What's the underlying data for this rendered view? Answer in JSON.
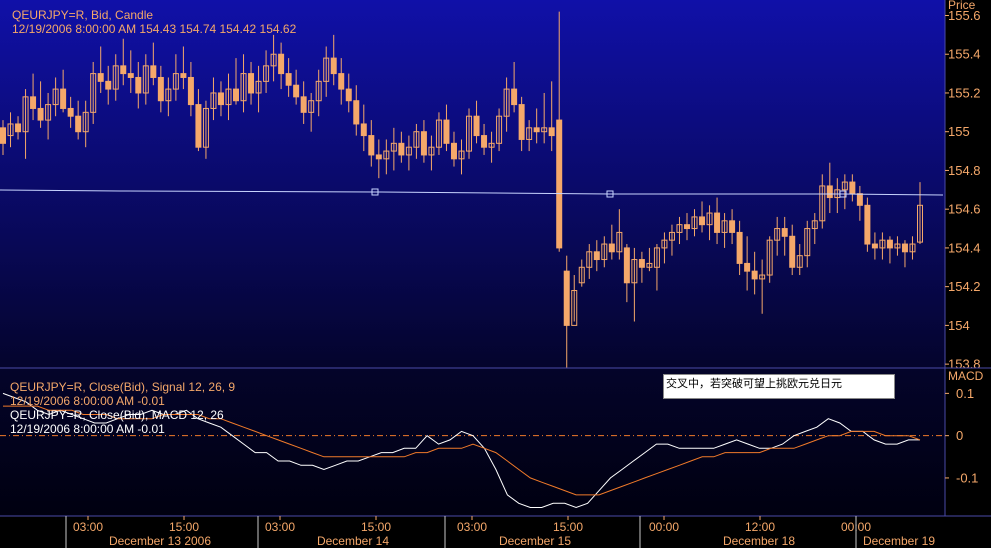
{
  "theme": {
    "upper_gradient_top": "#1010a8",
    "upper_gradient_bottom": "#04042c",
    "lower_gradient_top": "#04042a",
    "lower_gradient_bottom": "#000010",
    "candle_color": "#f5a86a",
    "macd_color": "#ffffff",
    "signal_color": "#f07a2a",
    "axis_text": "#f5a86a",
    "separator": "#4a4aa8"
  },
  "price_pane": {
    "title": "QEURJPY=R, Bid, Candle",
    "ohlc_text": "12/19/2006 8:00:00 AM 154.43 154.74 154.42 154.62",
    "axis_label": "Price",
    "trendline_color": "#c8d4ff"
  },
  "macd_pane": {
    "signal_title": "QEURJPY=R, Close(Bid), Signal 12, 26, 9",
    "signal_value_text": "12/19/2006 8:00:00 AM -0.01",
    "macd_title": "QEURJPY=R, Close(Bid), MACD 12, 26",
    "macd_value_text": "12/19/2006 8:00:00 AM -0.01",
    "axis_label": "MACD",
    "annotation": "交叉中，若突破可望上挑欧元兑日元"
  },
  "time_axis": {
    "ticks": [
      "03:00",
      "15:00",
      "03:00",
      "15:00",
      "03:00",
      "15:00",
      "00:00",
      "12:00",
      "00:00"
    ],
    "dates": [
      "December 13 2006",
      "December 14",
      "December 15",
      "December 18",
      "December 19"
    ]
  },
  "chart_data": [
    {
      "type": "candlestick",
      "title": "QEURJPY=R, Bid, Candle",
      "ylabel": "Price",
      "ylim": [
        153.78,
        155.68
      ],
      "yticks": [
        155.6,
        155.4,
        155.2,
        155,
        154.8,
        154.6,
        154.4,
        154.2,
        154,
        153.8
      ],
      "ytick_labels": [
        "155.6",
        "155.4",
        "155.2",
        "155",
        "154.8",
        "154.6",
        "154.4",
        "154.2",
        "154",
        "153.8"
      ],
      "last": {
        "time": "12/19/2006 8:00:00 AM",
        "open": 154.43,
        "high": 154.74,
        "low": 154.42,
        "close": 154.62
      },
      "candles": [
        [
          155.02,
          155.06,
          154.88,
          154.94
        ],
        [
          154.98,
          155.1,
          154.92,
          155.04
        ],
        [
          155.04,
          155.08,
          154.96,
          155.0
        ],
        [
          155.0,
          155.22,
          154.86,
          155.18
        ],
        [
          155.18,
          155.3,
          155.06,
          155.12
        ],
        [
          155.12,
          155.26,
          155.02,
          155.06
        ],
        [
          155.06,
          155.2,
          154.96,
          155.14
        ],
        [
          155.14,
          155.28,
          155.08,
          155.22
        ],
        [
          155.22,
          155.32,
          155.1,
          155.12
        ],
        [
          155.12,
          155.18,
          155.02,
          155.08
        ],
        [
          155.08,
          155.16,
          154.96,
          155.0
        ],
        [
          155.0,
          155.16,
          154.92,
          155.1
        ],
        [
          155.1,
          155.36,
          155.04,
          155.3
        ],
        [
          155.3,
          155.44,
          155.2,
          155.26
        ],
        [
          155.26,
          155.34,
          155.14,
          155.22
        ],
        [
          155.22,
          155.4,
          155.16,
          155.34
        ],
        [
          155.34,
          155.48,
          155.24,
          155.3
        ],
        [
          155.3,
          155.42,
          155.2,
          155.28
        ],
        [
          155.28,
          155.36,
          155.12,
          155.2
        ],
        [
          155.2,
          155.4,
          155.14,
          155.34
        ],
        [
          155.34,
          155.46,
          155.24,
          155.28
        ],
        [
          155.28,
          155.34,
          155.1,
          155.16
        ],
        [
          155.16,
          155.28,
          155.08,
          155.22
        ],
        [
          155.22,
          155.4,
          155.16,
          155.3
        ],
        [
          155.3,
          155.44,
          155.22,
          155.28
        ],
        [
          155.28,
          155.36,
          155.08,
          155.14
        ],
        [
          155.14,
          155.22,
          154.9,
          154.92
        ],
        [
          154.92,
          155.16,
          154.86,
          155.12
        ],
        [
          155.12,
          155.28,
          155.06,
          155.2
        ],
        [
          155.2,
          155.26,
          155.08,
          155.14
        ],
        [
          155.14,
          155.3,
          155.06,
          155.22
        ],
        [
          155.22,
          155.38,
          155.14,
          155.16
        ],
        [
          155.16,
          155.4,
          155.1,
          155.3
        ],
        [
          155.3,
          155.36,
          155.14,
          155.2
        ],
        [
          155.2,
          155.34,
          155.1,
          155.26
        ],
        [
          155.26,
          155.42,
          155.2,
          155.34
        ],
        [
          155.34,
          155.5,
          155.26,
          155.4
        ],
        [
          155.4,
          155.46,
          155.22,
          155.3
        ],
        [
          155.3,
          155.38,
          155.18,
          155.24
        ],
        [
          155.24,
          155.32,
          155.14,
          155.18
        ],
        [
          155.18,
          155.26,
          155.04,
          155.1
        ],
        [
          155.1,
          155.2,
          155.0,
          155.16
        ],
        [
          155.16,
          155.32,
          155.08,
          155.26
        ],
        [
          155.26,
          155.44,
          155.18,
          155.38
        ],
        [
          155.38,
          155.5,
          155.24,
          155.3
        ],
        [
          155.3,
          155.38,
          155.14,
          155.22
        ],
        [
          155.22,
          155.3,
          155.1,
          155.16
        ],
        [
          155.16,
          155.24,
          154.98,
          155.04
        ],
        [
          155.04,
          155.14,
          154.9,
          154.98
        ],
        [
          154.98,
          155.06,
          154.82,
          154.88
        ],
        [
          154.88,
          154.96,
          154.76,
          154.86
        ],
        [
          154.86,
          154.96,
          154.78,
          154.9
        ],
        [
          154.9,
          155.02,
          154.8,
          154.94
        ],
        [
          154.94,
          155.0,
          154.84,
          154.88
        ],
        [
          154.88,
          154.98,
          154.8,
          154.92
        ],
        [
          154.92,
          155.04,
          154.86,
          155.0
        ],
        [
          155.0,
          155.06,
          154.84,
          154.88
        ],
        [
          154.88,
          154.98,
          154.8,
          154.92
        ],
        [
          154.92,
          155.1,
          154.88,
          155.06
        ],
        [
          155.06,
          155.14,
          154.9,
          154.94
        ],
        [
          154.94,
          155.0,
          154.82,
          154.86
        ],
        [
          154.86,
          154.96,
          154.78,
          154.9
        ],
        [
          154.9,
          155.12,
          154.86,
          155.08
        ],
        [
          155.08,
          155.16,
          154.94,
          154.98
        ],
        [
          154.98,
          155.04,
          154.88,
          154.92
        ],
        [
          154.92,
          155.0,
          154.84,
          154.94
        ],
        [
          154.94,
          155.12,
          154.9,
          155.08
        ],
        [
          155.08,
          155.28,
          155.0,
          155.22
        ],
        [
          155.22,
          155.36,
          155.1,
          155.14
        ],
        [
          155.14,
          155.18,
          154.9,
          154.96
        ],
        [
          154.96,
          155.06,
          154.9,
          155.02
        ],
        [
          155.02,
          155.12,
          154.94,
          155.0
        ],
        [
          155.0,
          155.2,
          154.94,
          155.02
        ],
        [
          155.02,
          155.26,
          154.9,
          154.98
        ],
        [
          155.06,
          155.62,
          154.38,
          154.4
        ],
        [
          154.28,
          154.36,
          153.78,
          154.0
        ],
        [
          154.0,
          154.26,
          154.02,
          154.18
        ],
        [
          154.22,
          154.34,
          154.2,
          154.3
        ],
        [
          154.3,
          154.42,
          154.24,
          154.38
        ],
        [
          154.38,
          154.44,
          154.28,
          154.34
        ],
        [
          154.34,
          154.46,
          154.3,
          154.42
        ],
        [
          154.42,
          154.52,
          154.34,
          154.38
        ],
        [
          154.38,
          154.6,
          154.34,
          154.48
        ],
        [
          154.4,
          154.42,
          154.12,
          154.22
        ],
        [
          154.22,
          154.4,
          154.02,
          154.34
        ],
        [
          154.34,
          154.38,
          154.22,
          154.3
        ],
        [
          154.3,
          154.4,
          154.28,
          154.32
        ],
        [
          154.3,
          154.42,
          154.18,
          154.4
        ],
        [
          154.4,
          154.48,
          154.32,
          154.44
        ],
        [
          154.44,
          154.52,
          154.36,
          154.48
        ],
        [
          154.48,
          154.56,
          154.42,
          154.52
        ],
        [
          154.52,
          154.58,
          154.44,
          154.5
        ],
        [
          154.5,
          154.6,
          154.46,
          154.56
        ],
        [
          154.56,
          154.64,
          154.48,
          154.52
        ],
        [
          154.52,
          154.62,
          154.44,
          154.58
        ],
        [
          154.58,
          154.66,
          154.42,
          154.48
        ],
        [
          154.48,
          154.58,
          154.4,
          154.54
        ],
        [
          154.54,
          154.6,
          154.42,
          154.48
        ],
        [
          154.48,
          154.54,
          154.26,
          154.32
        ],
        [
          154.32,
          154.46,
          154.18,
          154.28
        ],
        [
          154.28,
          154.38,
          154.16,
          154.24
        ],
        [
          154.24,
          154.34,
          154.06,
          154.26
        ],
        [
          154.26,
          154.46,
          154.22,
          154.44
        ],
        [
          154.44,
          154.56,
          154.36,
          154.5
        ],
        [
          154.5,
          154.56,
          154.36,
          154.46
        ],
        [
          154.46,
          154.52,
          154.26,
          154.3
        ],
        [
          154.3,
          154.42,
          154.26,
          154.36
        ],
        [
          154.36,
          154.54,
          154.3,
          154.5
        ],
        [
          154.5,
          154.58,
          154.42,
          154.54
        ],
        [
          154.54,
          154.78,
          154.5,
          154.72
        ],
        [
          154.72,
          154.84,
          154.58,
          154.66
        ],
        [
          154.66,
          154.76,
          154.58,
          154.7
        ],
        [
          154.7,
          154.78,
          154.6,
          154.74
        ],
        [
          154.74,
          154.78,
          154.64,
          154.68
        ],
        [
          154.68,
          154.72,
          154.54,
          154.62
        ],
        [
          154.62,
          154.66,
          154.38,
          154.42
        ],
        [
          154.42,
          154.48,
          154.34,
          154.4
        ],
        [
          154.4,
          154.48,
          154.34,
          154.44
        ],
        [
          154.44,
          154.46,
          154.32,
          154.4
        ],
        [
          154.4,
          154.46,
          154.36,
          154.42
        ],
        [
          154.42,
          154.44,
          154.3,
          154.38
        ],
        [
          154.38,
          154.46,
          154.34,
          154.42
        ],
        [
          154.43,
          154.74,
          154.42,
          154.62
        ]
      ]
    },
    {
      "type": "line",
      "ylabel": "MACD",
      "ylim": [
        -0.19,
        0.16
      ],
      "yticks": [
        0.1,
        0,
        -0.1
      ],
      "ytick_labels": [
        "0.1",
        "0",
        "-0.1"
      ],
      "zero_line": 0,
      "series": [
        {
          "name": "QEURJPY=R, Close(Bid), MACD 12, 26",
          "color": "#ffffff",
          "values": [
            0.1,
            0.09,
            0.08,
            0.06,
            0.05,
            0.06,
            0.05,
            0.04,
            0.03,
            0.03,
            0.04,
            0.05,
            0.05,
            0.06,
            0.05,
            0.05,
            0.06,
            0.04,
            0.03,
            0.02,
            0.0,
            -0.02,
            -0.04,
            -0.04,
            -0.06,
            -0.06,
            -0.07,
            -0.07,
            -0.08,
            -0.07,
            -0.06,
            -0.06,
            -0.05,
            -0.04,
            -0.04,
            -0.03,
            -0.03,
            0.0,
            -0.02,
            -0.01,
            0.01,
            0.0,
            -0.03,
            -0.08,
            -0.14,
            -0.16,
            -0.17,
            -0.17,
            -0.16,
            -0.16,
            -0.17,
            -0.16,
            -0.13,
            -0.1,
            -0.08,
            -0.06,
            -0.04,
            -0.02,
            -0.02,
            -0.03,
            -0.03,
            -0.03,
            -0.03,
            -0.02,
            -0.01,
            -0.02,
            -0.03,
            -0.03,
            -0.02,
            0.0,
            0.01,
            0.02,
            0.04,
            0.03,
            0.01,
            0.01,
            -0.01,
            -0.02,
            -0.02,
            -0.01,
            -0.01
          ]
        },
        {
          "name": "QEURJPY=R, Close(Bid), Signal 12, 26, 9",
          "color": "#f07a2a",
          "values": [
            0.07,
            0.07,
            0.07,
            0.07,
            0.06,
            0.06,
            0.06,
            0.05,
            0.05,
            0.05,
            0.04,
            0.04,
            0.04,
            0.04,
            0.05,
            0.05,
            0.05,
            0.05,
            0.04,
            0.04,
            0.03,
            0.02,
            0.01,
            0.0,
            -0.01,
            -0.02,
            -0.03,
            -0.04,
            -0.05,
            -0.05,
            -0.05,
            -0.05,
            -0.05,
            -0.05,
            -0.05,
            -0.05,
            -0.04,
            -0.04,
            -0.03,
            -0.03,
            -0.03,
            -0.02,
            -0.03,
            -0.04,
            -0.06,
            -0.08,
            -0.1,
            -0.11,
            -0.12,
            -0.13,
            -0.14,
            -0.14,
            -0.14,
            -0.13,
            -0.12,
            -0.11,
            -0.1,
            -0.09,
            -0.08,
            -0.07,
            -0.06,
            -0.05,
            -0.05,
            -0.04,
            -0.04,
            -0.04,
            -0.04,
            -0.03,
            -0.03,
            -0.03,
            -0.02,
            -0.01,
            0.0,
            0.0,
            0.01,
            0.01,
            0.01,
            0.0,
            0.0,
            0.0,
            -0.01
          ]
        }
      ]
    }
  ]
}
